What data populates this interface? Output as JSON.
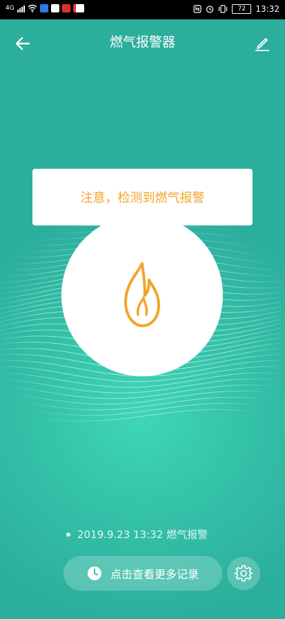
{
  "status_bar": {
    "network": "4G",
    "battery": "72",
    "time": "13:32"
  },
  "nav": {
    "title": "燃气报警器"
  },
  "alert": {
    "message": "注意，检测到燃气报警"
  },
  "record": {
    "text": "2019.9.23 13:32 燃气报警"
  },
  "actions": {
    "history_label": "点击查看更多记录"
  },
  "colors": {
    "accent": "#f2a52b",
    "background": "#34c3a9"
  },
  "icons": {
    "back": "back-arrow-icon",
    "edit": "edit-icon",
    "flame": "flame-icon",
    "clock": "clock-icon",
    "settings": "gear-icon"
  }
}
